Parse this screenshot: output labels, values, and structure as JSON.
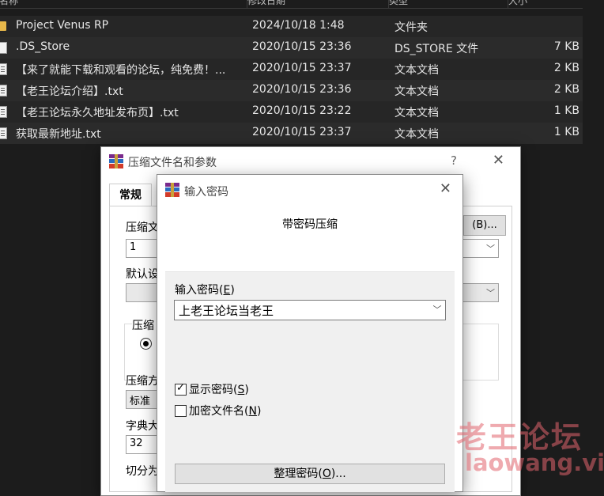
{
  "explorer": {
    "columns": [
      "名称",
      "修改日期",
      "类型",
      "大小"
    ],
    "files": [
      {
        "name": "Project Venus RP",
        "date": "2024/10/18 1:48",
        "type": "文件夹",
        "size": "",
        "icon": "folder-icon"
      },
      {
        "name": ".DS_Store",
        "date": "2020/10/15 23:36",
        "type": "DS_STORE 文件",
        "size": "7 KB",
        "icon": "file-icon"
      },
      {
        "name": "【来了就能下载和观看的论坛，纯免费！...",
        "date": "2020/10/15 23:37",
        "type": "文本文档",
        "size": "2 KB",
        "icon": "text-file-icon"
      },
      {
        "name": "【老王论坛介绍】.txt",
        "date": "2020/10/15 23:36",
        "type": "文本文档",
        "size": "2 KB",
        "icon": "text-file-icon"
      },
      {
        "name": "【老王论坛永久地址发布页】.txt",
        "date": "2020/10/15 23:22",
        "type": "文本文档",
        "size": "1 KB",
        "icon": "text-file-icon"
      },
      {
        "name": "获取最新地址.txt",
        "date": "2020/10/15 23:37",
        "type": "文本文档",
        "size": "1 KB",
        "icon": "text-file-icon"
      }
    ]
  },
  "archive_dialog": {
    "title": "压缩文件名和参数",
    "help": "?",
    "close": "✕",
    "tab_general": "常规",
    "archive_name_label": "压缩文",
    "archive_name_value": "1",
    "browse_label": "(B)...",
    "default_profile_label": "默认设",
    "format_group_label": "压缩",
    "method_label": "压缩方",
    "method_value": "标准",
    "dict_label": "字典大",
    "dict_value": "32",
    "split_label": "切分为"
  },
  "password_dialog": {
    "title": "输入密码",
    "close": "✕",
    "heading": "带密码压缩",
    "password_label": "输入密码",
    "password_hotkey": "E",
    "password_value": "上老王论坛当老王",
    "show_password_label": "显示密码",
    "show_password_hotkey": "S",
    "show_password_checked": true,
    "encrypt_names_label": "加密文件名",
    "encrypt_names_hotkey": "N",
    "encrypt_names_checked": false,
    "organize_label": "整理密码",
    "organize_hotkey": "O"
  },
  "watermark": {
    "cn": "老王论坛",
    "en": "laowang.vip"
  },
  "colors": {
    "explorer_bg": "#1c1c1c",
    "row_bg": "#2b2b2b",
    "folder": "#e8b84a",
    "watermark": "#e2646e"
  }
}
